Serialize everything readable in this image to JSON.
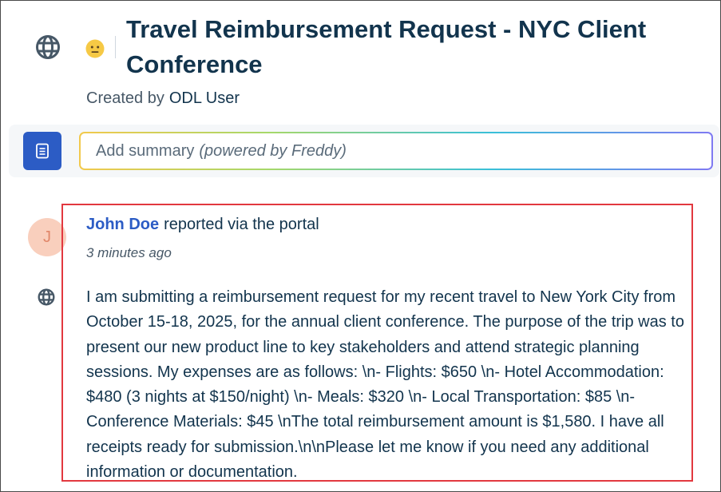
{
  "ticket": {
    "title": "Travel Reimbursement Request - NYC Client Conference",
    "created_by_label": "Created by",
    "created_by_user": "ODL User"
  },
  "summary": {
    "placeholder": "Add summary",
    "powered_by": "(powered by Freddy)"
  },
  "conversation": {
    "avatar_initial": "J",
    "author_name": "John Doe",
    "source_text": "reported via the portal",
    "timestamp": "3 minutes ago",
    "body": "I am submitting a reimbursement request for my recent travel to New York City from October 15-18, 2025, for the annual client conference. The purpose of the trip was to present our new product line to key stakeholders and attend strategic planning sessions. My expenses are as follows: \\n- Flights: $650 \\n- Hotel Accommodation: $480 (3 nights at $150/night) \\n- Meals: $320 \\n- Local Transportation: $85 \\n- Conference Materials: $45 \\nThe total reimbursement amount is $1,580. I have all receipts ready for submission.\\n\\nPlease let me know if you need any additional information or documentation."
  },
  "icons": {
    "channel": "globe-icon",
    "sentiment": "neutral-face-icon",
    "summary": "document-icon"
  },
  "colors": {
    "brand_blue": "#2c5cc5",
    "highlight_border": "#e2383f",
    "text_dark": "#12344d"
  }
}
